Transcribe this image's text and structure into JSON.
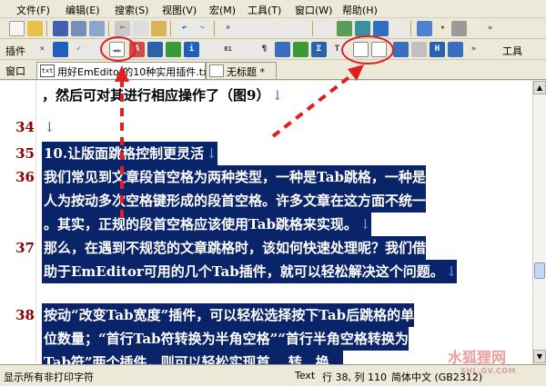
{
  "menubar": {
    "items": [
      {
        "label": "文件(F)"
      },
      {
        "label": "编辑(E)"
      },
      {
        "label": "搜索(S)"
      },
      {
        "label": "视图(V)"
      },
      {
        "label": "宏(M)"
      },
      {
        "label": "工具(T)"
      },
      {
        "label": "窗口(W)"
      },
      {
        "label": "帮助(H)"
      }
    ]
  },
  "toolbar_plugins": {
    "label": "插件",
    "right_label": "工具"
  },
  "tabbar": {
    "label": "窗口",
    "tabs": [
      {
        "label": "用好EmEditor的10种实用插件.txt",
        "icon": "txt"
      },
      {
        "label": "无标题 *",
        "icon": "doc"
      }
    ]
  },
  "editor": {
    "lines": [
      {
        "num": "",
        "text": "，然后可对其进行相应操作了（图9）",
        "eol": "↓",
        "selected": false
      },
      {
        "num": "34",
        "text": "",
        "eol": "↓",
        "selected": false
      },
      {
        "num": "35",
        "text": "10.让版面跳格控制更灵活",
        "eol": "↓",
        "selected": true
      },
      {
        "num": "36",
        "text": "我们常见到文章段首空格为两种类型，一种是Tab跳格，一种是",
        "eol": "",
        "selected": true
      },
      {
        "num": "",
        "text": "人为按动多次空格键形成的段首空格。许多文章在这方面不统一",
        "eol": "",
        "selected": true
      },
      {
        "num": "",
        "text": "。其实，正规的段首空格应该使用Tab跳格来实现。",
        "eol": "↓",
        "selected": true
      },
      {
        "num": "37",
        "text": "那么，在遇到不规范的文章跳格时，该如何快速处理呢？我们借",
        "eol": "",
        "selected": true
      },
      {
        "num": "",
        "text": "助于EmEditor可用的几个Tab插件，就可以轻松解决这个问题。",
        "eol": "↓",
        "selected": true
      },
      {
        "num": "38",
        "text": "按动“改变Tab宽度”插件，可以轻松选择按下Tab后跳格的单",
        "eol": "",
        "selected": true
      },
      {
        "num": "",
        "text": "位数量；“首行Tab符转换为半角空格”“首行半角空格转换为",
        "eol": "",
        "selected": true
      },
      {
        "num": "",
        "text": "Tab符”两个插件，则可以轻松实现首… 转…换…",
        "eol": "",
        "selected": true
      }
    ]
  },
  "statusbar": {
    "left_text": "显示所有非打印字符",
    "encoding_mode": "Text",
    "position": "行 38, 列 110",
    "encoding": "简体中文 (GB2312)"
  },
  "watermark": {
    "text": "水狐狸网",
    "sub": "SHL.GV.COM"
  },
  "colors": {
    "selection": "#0a246a",
    "line_number": "#8b0000",
    "annotation": "#e02020",
    "chrome": "#ece9d8"
  }
}
